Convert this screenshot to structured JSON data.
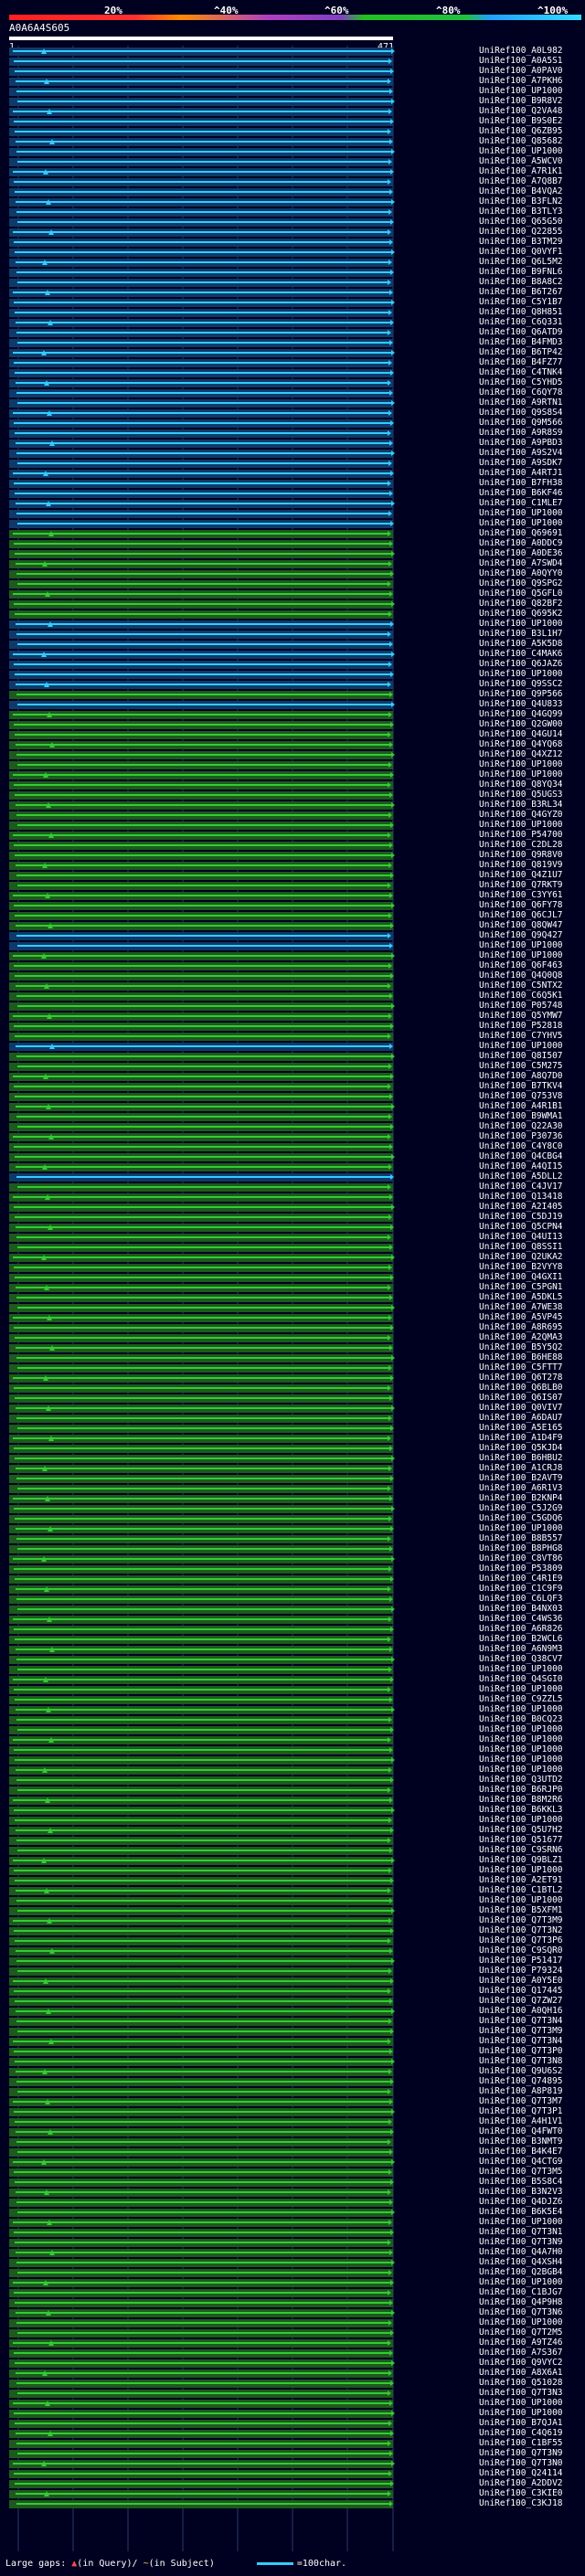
{
  "scale": {
    "markers": [
      "20%",
      "^40%",
      "^60%",
      "^80%",
      "^100%"
    ],
    "colors": [
      "#ff2020",
      "#ff8a00",
      "#a030c0",
      "#22c020",
      "#20a0ff",
      "#33ddff"
    ]
  },
  "query": {
    "id": "A0A6A4S605",
    "start": "1",
    "end": "471"
  },
  "footer": {
    "large_gaps_label": "Large gaps:",
    "in_query": "(in Query)",
    "in_subject": "(in Subject)",
    "scale_label": "=100char."
  },
  "hits": [
    "UniRef100_A0L982",
    "UniRef100_A0A5S1",
    "UniRef100_A0PAV0",
    "UniRef100_A7PKH6",
    "UniRef100_UP1000",
    "UniRef100_B9R8V2",
    "UniRef100_Q2VA48",
    "UniRef100_B9S0E2",
    "UniRef100_Q6ZB95",
    "UniRef100_Q85682",
    "UniRef100_UP1000",
    "UniRef100_A5WCV0",
    "UniRef100_A7R1K1",
    "UniRef100_A7Q8B7",
    "UniRef100_B4VQA2",
    "UniRef100_B3FLN2",
    "UniRef100_B3TLY3",
    "UniRef100_Q65G50",
    "UniRef100_Q22855",
    "UniRef100_B3TM29",
    "UniRef100_Q0VYF1",
    "UniRef100_Q6L5M2",
    "UniRef100_B9FNL6",
    "UniRef100_B8A8C2",
    "UniRef100_B6T267",
    "UniRef100_C5Y1B7",
    "UniRef100_Q8H851",
    "UniRef100_C6Q331",
    "UniRef100_Q6ATD9",
    "UniRef100_B4FMD3",
    "UniRef100_B6TP42",
    "UniRef100_B4FZ77",
    "UniRef100_C4TNK4",
    "UniRef100_C5YHD5",
    "UniRef100_C6QY78",
    "UniRef100_A9RTN1",
    "UniRef100_Q9S8S4",
    "UniRef100_Q9M566",
    "UniRef100_A9R8S9",
    "UniRef100_A9PBD3",
    "UniRef100_A9S2V4",
    "UniRef100_A9SDK7",
    "UniRef100_A4RTJ1",
    "UniRef100_B7FH38",
    "UniRef100_B6KF46",
    "UniRef100_C1MLE7",
    "UniRef100_UP1000",
    "UniRef100_UP1000",
    "UniRef100_Q69691",
    "UniRef100_A0DDC9",
    "UniRef100_A0DE36",
    "UniRef100_A7SWD4",
    "UniRef100_A0QYY0",
    "UniRef100_Q9SPG2",
    "UniRef100_Q5GFL0",
    "UniRef100_Q82BF2",
    "UniRef100_Q695K2",
    "UniRef100_UP1000",
    "UniRef100_B3L1H7",
    "UniRef100_A5K5D8",
    "UniRef100_C4MAK6",
    "UniRef100_Q6JAZ6",
    "UniRef100_UP1000",
    "UniRef100_Q9SSC2",
    "UniRef100_Q9P566",
    "UniRef100_Q4U833",
    "UniRef100_Q4GQ99",
    "UniRef100_Q2GW00",
    "UniRef100_Q4GU14",
    "UniRef100_Q4YQ68",
    "UniRef100_Q4XZ12",
    "UniRef100_UP1000",
    "UniRef100_UP1000",
    "UniRef100_Q8YQ34",
    "UniRef100_Q5UGS3",
    "UniRef100_B3RL34",
    "UniRef100_Q4GYZ0",
    "UniRef100_UP1000",
    "UniRef100_P54700",
    "UniRef100_C2DL28",
    "UniRef100_Q9R8V0",
    "UniRef100_Q819V9",
    "UniRef100_Q4Z1U7",
    "UniRef100_Q7RKT9",
    "UniRef100_C3YY61",
    "UniRef100_Q6FY78",
    "UniRef100_Q6CJL7",
    "UniRef100_Q8QW47",
    "UniRef100_Q9Q427",
    "UniRef100_UP1000",
    "UniRef100_UP1000",
    "UniRef100_Q6F463",
    "UniRef100_Q4Q0Q8",
    "UniRef100_C5NTX2",
    "UniRef100_C6Q5K1",
    "UniRef100_P05748",
    "UniRef100_Q5YMW7",
    "UniRef100_P52818",
    "UniRef100_C7YHV5",
    "UniRef100_UP1000",
    "UniRef100_Q8I507",
    "UniRef100_C5M275",
    "UniRef100_A8Q7D0",
    "UniRef100_B7TKV4",
    "UniRef100_Q753V8",
    "UniRef100_A4R1B1",
    "UniRef100_B9WMA1",
    "UniRef100_Q22A30",
    "UniRef100_P30736",
    "UniRef100_C4Y8C0",
    "UniRef100_Q4CBG4",
    "UniRef100_A4QI15",
    "UniRef100_A5DLL2",
    "UniRef100_C4JV17",
    "UniRef100_Q13418",
    "UniRef100_A2I405",
    "UniRef100_C5DJ19",
    "UniRef100_Q5CPN4",
    "UniRef100_Q4UI13",
    "UniRef100_Q8SSI1",
    "UniRef100_Q2UKA2",
    "UniRef100_B2VYY8",
    "UniRef100_Q4GXI1",
    "UniRef100_C5PGN1",
    "UniRef100_A5DKL5",
    "UniRef100_A7WE38",
    "UniRef100_A5VP45",
    "UniRef100_A8R695",
    "UniRef100_A2QMA3",
    "UniRef100_B5Y5Q2",
    "UniRef100_B6HE88",
    "UniRef100_C5FTT7",
    "UniRef100_Q6T278",
    "UniRef100_Q6BLB0",
    "UniRef100_Q6IS07",
    "UniRef100_Q0VIV7",
    "UniRef100_A6DAU7",
    "UniRef100_A5E165",
    "UniRef100_A1D4F9",
    "UniRef100_Q5KJD4",
    "UniRef100_B6HBU2",
    "UniRef100_A1CRJ8",
    "UniRef100_B2AVT9",
    "UniRef100_A6R1V3",
    "UniRef100_B2KNP4",
    "UniRef100_C5J2G9",
    "UniRef100_C5GDQ6",
    "UniRef100_UP1000",
    "UniRef100_B8B557",
    "UniRef100_B8PHG8",
    "UniRef100_C8VT86",
    "UniRef100_P53809",
    "UniRef100_C4R1E9",
    "UniRef100_C1C9F9",
    "UniRef100_C6LQF3",
    "UniRef100_B4NX03",
    "UniRef100_C4WS36",
    "UniRef100_A6R826",
    "UniRef100_B2WCL6",
    "UniRef100_A6N9M3",
    "UniRef100_Q38CV7",
    "UniRef100_UP1000",
    "UniRef100_Q4SGI0",
    "UniRef100_UP1000",
    "UniRef100_C9ZZL5",
    "UniRef100_UP1000",
    "UniRef100_B0CQ23",
    "UniRef100_UP1000",
    "UniRef100_UP1000",
    "UniRef100_UP1000",
    "UniRef100_UP1000",
    "UniRef100_UP1000",
    "UniRef100_Q3UTD2",
    "UniRef100_B6RJP0",
    "UniRef100_B8M2R6",
    "UniRef100_B6KKL3",
    "UniRef100_UP1000",
    "UniRef100_Q5U7H2",
    "UniRef100_Q51677",
    "UniRef100_C9SRN6",
    "UniRef100_Q9BLZ1",
    "UniRef100_UP1000",
    "UniRef100_A2ET91",
    "UniRef100_C1BTL2",
    "UniRef100_UP1000",
    "UniRef100_B5XFM1",
    "UniRef100_Q7T3M9",
    "UniRef100_Q7T3N2",
    "UniRef100_Q7T3P6",
    "UniRef100_C9SQR0",
    "UniRef100_P51417",
    "UniRef100_P79324",
    "UniRef100_A0Y5E0",
    "UniRef100_Q17445",
    "UniRef100_Q7ZW27",
    "UniRef100_A0QH16",
    "UniRef100_Q7T3N4",
    "UniRef100_Q7T3M9",
    "UniRef100_Q7T3N4",
    "UniRef100_Q7T3P0",
    "UniRef100_Q7T3N8",
    "UniRef100_Q9U6S2",
    "UniRef100_Q74895",
    "UniRef100_A8P819",
    "UniRef100_Q7T3M7",
    "UniRef100_Q7T3P1",
    "UniRef100_A4H1V1",
    "UniRef100_Q4FWT0",
    "UniRef100_B3NMT9",
    "UniRef100_B4K4E7",
    "UniRef100_Q4CTG9",
    "UniRef100_Q7T3M5",
    "UniRef100_B5S8C4",
    "UniRef100_B3N2V3",
    "UniRef100_Q4DJZ6",
    "UniRef100_B6K5E4",
    "UniRef100_UP1000",
    "UniRef100_Q7T3N1",
    "UniRef100_Q7T3N9",
    "UniRef100_Q4A7H0",
    "UniRef100_Q4XSH4",
    "UniRef100_Q2BGB4",
    "UniRef100_UP1000",
    "UniRef100_C1BJG7",
    "UniRef100_Q4P9H8",
    "UniRef100_Q7T3N6",
    "UniRef100_UP1000",
    "UniRef100_Q7T2M5",
    "UniRef100_A9TZ46",
    "UniRef100_A7S367",
    "UniRef100_Q9VYC2",
    "UniRef100_A8X6A1",
    "UniRef100_Q51028",
    "UniRef100_Q7T3N3",
    "UniRef100_UP1000",
    "UniRef100_UP1000",
    "UniRef100_B7QJA1",
    "UniRef100_C4Q619",
    "UniRef100_C1BF55",
    "UniRef100_Q7T3N9",
    "UniRef100_Q7T3N0",
    "UniRef100_Q24114",
    "UniRef100_A2DDV2",
    "UniRef100_C3KIE0",
    "UniRef100_C3KJ18"
  ]
}
